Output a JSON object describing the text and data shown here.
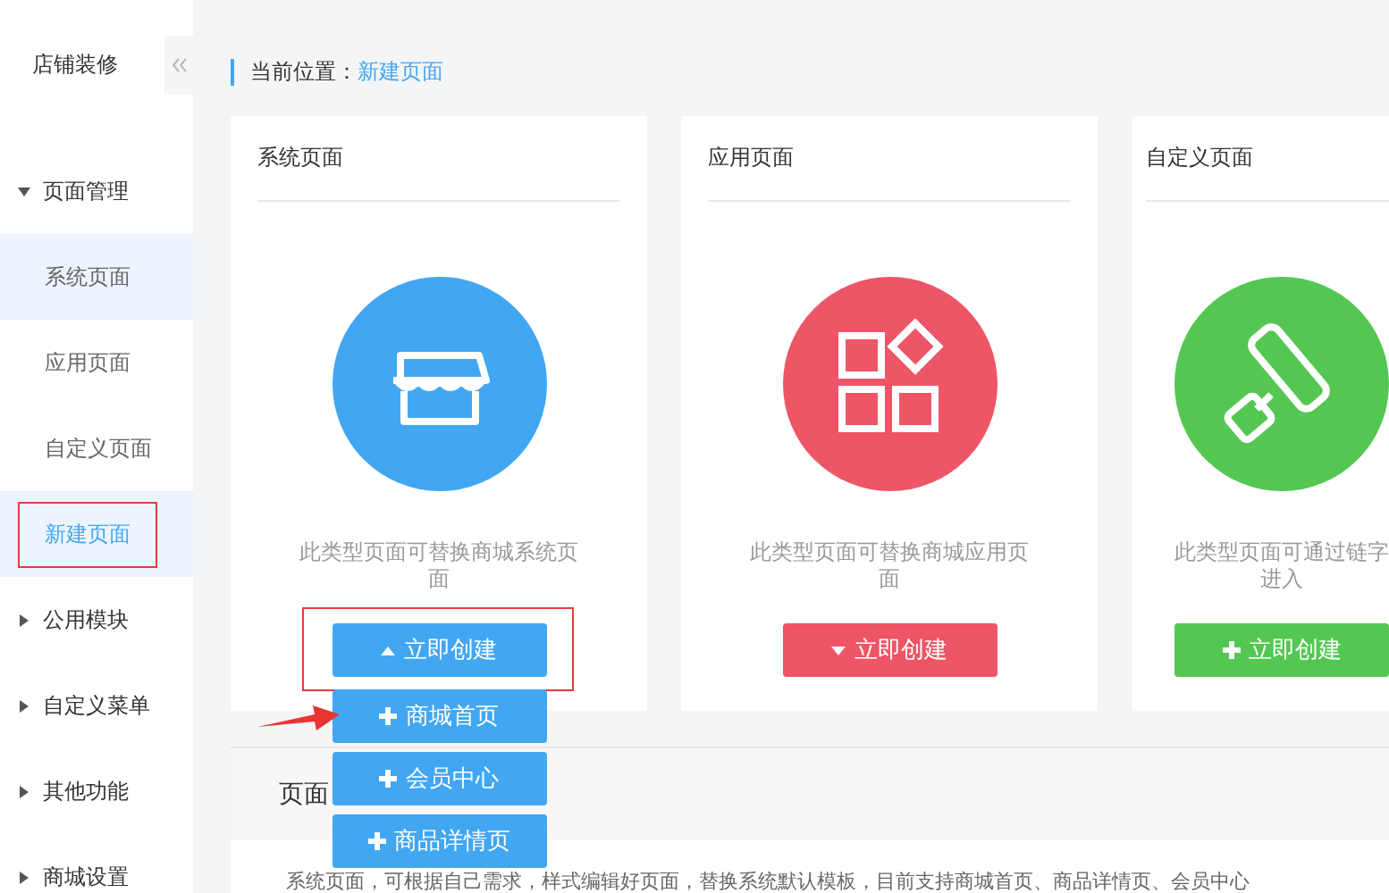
{
  "sidebar": {
    "title": "店铺装修",
    "groups": [
      {
        "label": "页面管理",
        "expanded": true,
        "children": [
          {
            "label": "系统页面",
            "selected": false,
            "hovered": true,
            "outlined": false
          },
          {
            "label": "应用页面",
            "selected": false,
            "hovered": false,
            "outlined": false
          },
          {
            "label": "自定义页面",
            "selected": false,
            "hovered": false,
            "outlined": false
          },
          {
            "label": "新建页面",
            "selected": true,
            "hovered": false,
            "outlined": true
          }
        ]
      },
      {
        "label": "公用模块",
        "expanded": false
      },
      {
        "label": "自定义菜单",
        "expanded": false
      },
      {
        "label": "其他功能",
        "expanded": false
      },
      {
        "label": "商城设置",
        "expanded": false
      }
    ]
  },
  "breadcrumb": {
    "label": "当前位置：",
    "current": "新建页面"
  },
  "cards": [
    {
      "title": "系统页面",
      "color": "#42a7f2",
      "description": "此类型页面可替换商城系统页面",
      "button": "立即创建",
      "kind": "dropdown",
      "expanded": true,
      "outlined": true,
      "menu": [
        {
          "label": "商城首页",
          "pointed": true
        },
        {
          "label": "会员中心",
          "pointed": false
        },
        {
          "label": "商品详情页",
          "pointed": false
        }
      ]
    },
    {
      "title": "应用页面",
      "color": "#ee5566",
      "description": "此类型页面可替换商城应用页面",
      "button": "立即创建",
      "kind": "dropdown",
      "expanded": false,
      "outlined": false
    },
    {
      "title": "自定义页面",
      "color": "#53c752",
      "description": "此类型页面可通过链字进入",
      "button": "立即创建",
      "kind": "direct",
      "outlined": false
    }
  ],
  "section": {
    "title": "页面",
    "text": "系统页面，可根据自己需求，样式编辑好页面，替换系统默认模板，目前支持商城首页、商品详情页、会员中心"
  }
}
